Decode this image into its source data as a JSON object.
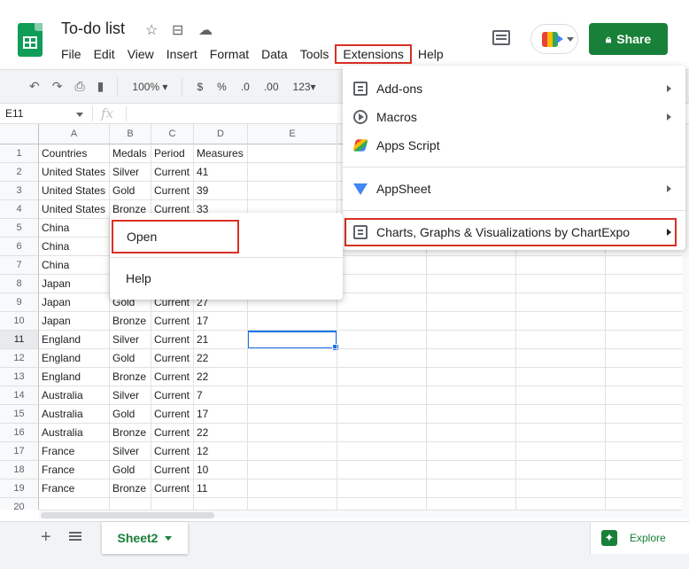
{
  "app": {
    "title": "To-do list",
    "menus": [
      "File",
      "Edit",
      "View",
      "Insert",
      "Format",
      "Data",
      "Tools",
      "Extensions",
      "Help"
    ],
    "active_menu": "Extensions",
    "share_label": "Share"
  },
  "toolbar": {
    "zoom": "100%",
    "currency": "$",
    "percent": "%",
    "decrease_decimal": ".0",
    "increase_decimal": ".00",
    "format_more": "123"
  },
  "formula_bar": {
    "cell_ref": "E11",
    "fx_label": "fx",
    "content": ""
  },
  "grid": {
    "columns": [
      "A",
      "B",
      "C",
      "D",
      "E"
    ],
    "row_numbers": [
      "1",
      "2",
      "3",
      "4",
      "5",
      "6",
      "7",
      "8",
      "9",
      "10",
      "11",
      "12",
      "13",
      "14",
      "15",
      "16",
      "17",
      "18",
      "19",
      "20"
    ],
    "selected_cell": "E11",
    "rows": [
      [
        "Countries",
        "Medals",
        "Period",
        "Measures"
      ],
      [
        "United States",
        "Silver",
        "Current",
        "41"
      ],
      [
        "United States",
        "Gold",
        "Current",
        "39"
      ],
      [
        "United States",
        "Bronze",
        "Current",
        "33"
      ],
      [
        "China",
        "",
        "",
        ""
      ],
      [
        "China",
        "",
        "",
        ""
      ],
      [
        "China",
        "",
        "",
        ""
      ],
      [
        "Japan",
        "",
        "",
        ""
      ],
      [
        "Japan",
        "Gold",
        "Current",
        "27"
      ],
      [
        "Japan",
        "Bronze",
        "Current",
        "17"
      ],
      [
        "England",
        "Silver",
        "Current",
        "21"
      ],
      [
        "England",
        "Gold",
        "Current",
        "22"
      ],
      [
        "England",
        "Bronze",
        "Current",
        "22"
      ],
      [
        "Australia",
        "Silver",
        "Current",
        "7"
      ],
      [
        "Australia",
        "Gold",
        "Current",
        "17"
      ],
      [
        "Australia",
        "Bronze",
        "Current",
        "22"
      ],
      [
        "France",
        "Silver",
        "Current",
        "12"
      ],
      [
        "France",
        "Gold",
        "Current",
        "10"
      ],
      [
        "France",
        "Bronze",
        "Current",
        "11"
      ],
      [
        "",
        "",
        "",
        ""
      ]
    ]
  },
  "extensions_menu": {
    "items": [
      {
        "label": "Add-ons",
        "icon": "add-ons-icon",
        "submenu": true
      },
      {
        "label": "Macros",
        "icon": "macros-icon",
        "submenu": true
      },
      {
        "label": "Apps Script",
        "icon": "apps-script-icon",
        "submenu": false
      },
      {
        "label": "AppSheet",
        "icon": "appsheet-icon",
        "submenu": true
      },
      {
        "label": "Charts, Graphs & Visualizations by ChartExpo",
        "icon": "chartexpo-icon",
        "submenu": true,
        "highlighted": true
      }
    ]
  },
  "chartexpo_submenu": {
    "items": [
      "Open",
      "Help"
    ],
    "highlighted": "Open"
  },
  "sheet_bar": {
    "tab_name": "Sheet2",
    "explore_label": "Explore"
  },
  "colors": {
    "accent_green": "#188038",
    "sheets_green": "#0f9d58",
    "highlight_red": "#d93025",
    "selection_blue": "#1a73e8"
  }
}
